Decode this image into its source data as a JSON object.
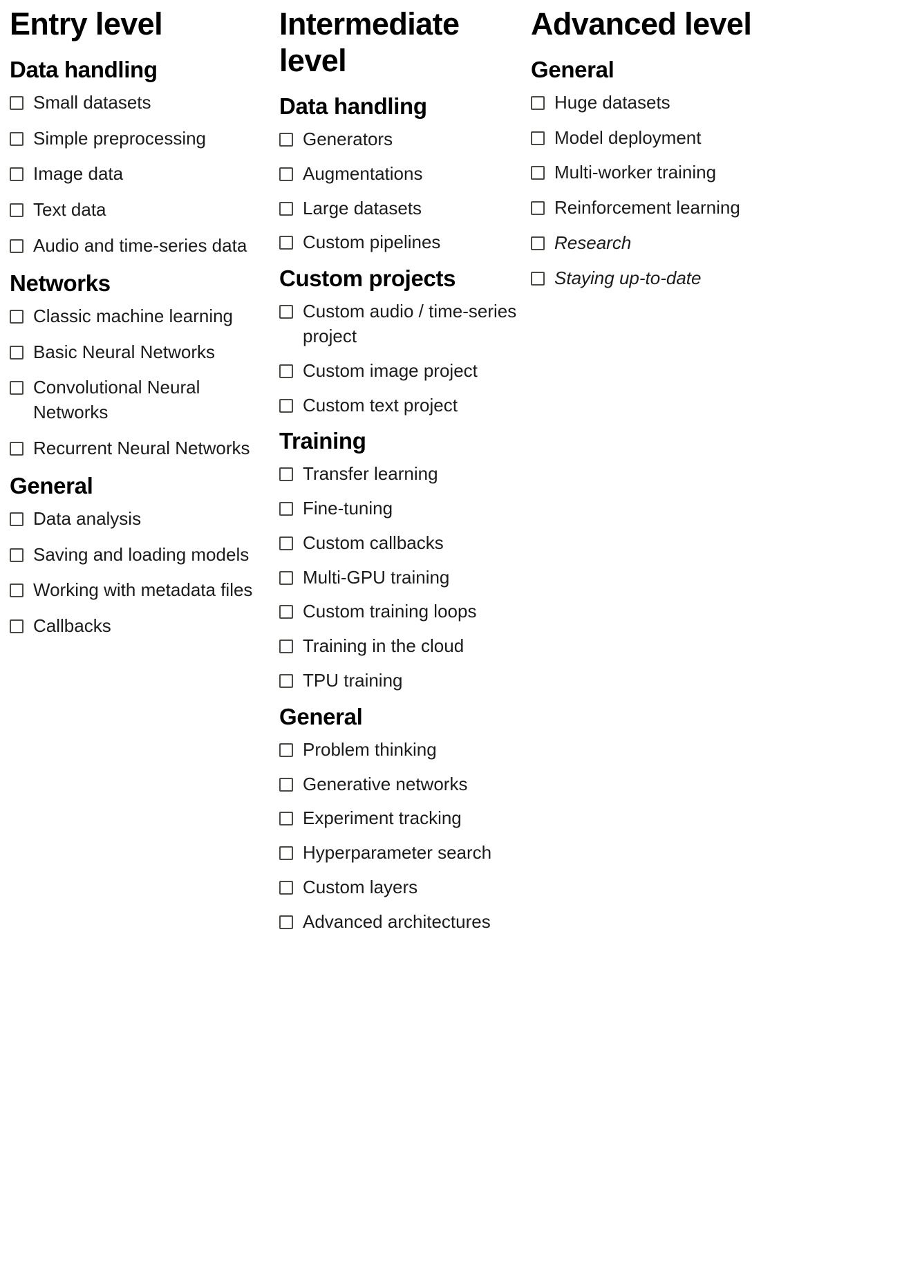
{
  "columns": [
    {
      "title": "Entry level",
      "sections": [
        {
          "title": "Data handling",
          "items": [
            {
              "label": "Small datasets",
              "checked": false,
              "italic": false
            },
            {
              "label": "Simple preprocessing",
              "checked": false,
              "italic": false
            },
            {
              "label": "Image data",
              "checked": false,
              "italic": false
            },
            {
              "label": "Text data",
              "checked": false,
              "italic": false
            },
            {
              "label": "Audio and time-series data",
              "checked": false,
              "italic": false
            }
          ]
        },
        {
          "title": "Networks",
          "items": [
            {
              "label": "Classic machine learning",
              "checked": false,
              "italic": false
            },
            {
              "label": "Basic Neural Networks",
              "checked": false,
              "italic": false
            },
            {
              "label": "Convolutional Neural Networks",
              "checked": false,
              "italic": false
            },
            {
              "label": "Recurrent Neural Networks",
              "checked": false,
              "italic": false
            }
          ]
        },
        {
          "title": "General",
          "items": [
            {
              "label": "Data analysis",
              "checked": false,
              "italic": false
            },
            {
              "label": "Saving and loading models",
              "checked": false,
              "italic": false
            },
            {
              "label": "Working with metadata files",
              "checked": false,
              "italic": false
            },
            {
              "label": "Callbacks",
              "checked": false,
              "italic": false
            }
          ]
        }
      ]
    },
    {
      "title": "Intermediate level",
      "sections": [
        {
          "title": "Data handling",
          "items": [
            {
              "label": "Generators",
              "checked": false,
              "italic": false
            },
            {
              "label": "Augmentations",
              "checked": false,
              "italic": false
            },
            {
              "label": "Large datasets",
              "checked": false,
              "italic": false
            },
            {
              "label": "Custom pipelines",
              "checked": false,
              "italic": false
            }
          ]
        },
        {
          "title": "Custom projects",
          "items": [
            {
              "label": "Custom audio / time-series project",
              "checked": false,
              "italic": false
            },
            {
              "label": "Custom image project",
              "checked": false,
              "italic": false
            },
            {
              "label": "Custom text project",
              "checked": false,
              "italic": false
            }
          ]
        },
        {
          "title": "Training",
          "items": [
            {
              "label": "Transfer learning",
              "checked": false,
              "italic": false
            },
            {
              "label": "Fine-tuning",
              "checked": false,
              "italic": false
            },
            {
              "label": "Custom callbacks",
              "checked": false,
              "italic": false
            },
            {
              "label": "Multi-GPU training",
              "checked": false,
              "italic": false
            },
            {
              "label": "Custom training loops",
              "checked": false,
              "italic": false
            },
            {
              "label": "Training in the cloud",
              "checked": false,
              "italic": false
            },
            {
              "label": "TPU training",
              "checked": false,
              "italic": false
            }
          ]
        },
        {
          "title": "General",
          "items": [
            {
              "label": "Problem thinking",
              "checked": false,
              "italic": false
            },
            {
              "label": "Generative networks",
              "checked": false,
              "italic": false
            },
            {
              "label": "Experiment tracking",
              "checked": false,
              "italic": false
            },
            {
              "label": "Hyperparameter search",
              "checked": false,
              "italic": false
            },
            {
              "label": "Custom layers",
              "checked": false,
              "italic": false
            },
            {
              "label": "Advanced architectures",
              "checked": false,
              "italic": false
            }
          ]
        }
      ]
    },
    {
      "title": "Advanced level",
      "sections": [
        {
          "title": "General",
          "items": [
            {
              "label": "Huge datasets",
              "checked": false,
              "italic": false
            },
            {
              "label": "Model deployment",
              "checked": false,
              "italic": false
            },
            {
              "label": "Multi-worker training",
              "checked": false,
              "italic": false
            },
            {
              "label": "Reinforcement learning",
              "checked": false,
              "italic": false
            },
            {
              "label": "Research",
              "checked": false,
              "italic": true
            },
            {
              "label": "Staying up-to-date",
              "checked": false,
              "italic": true
            }
          ]
        }
      ]
    }
  ]
}
